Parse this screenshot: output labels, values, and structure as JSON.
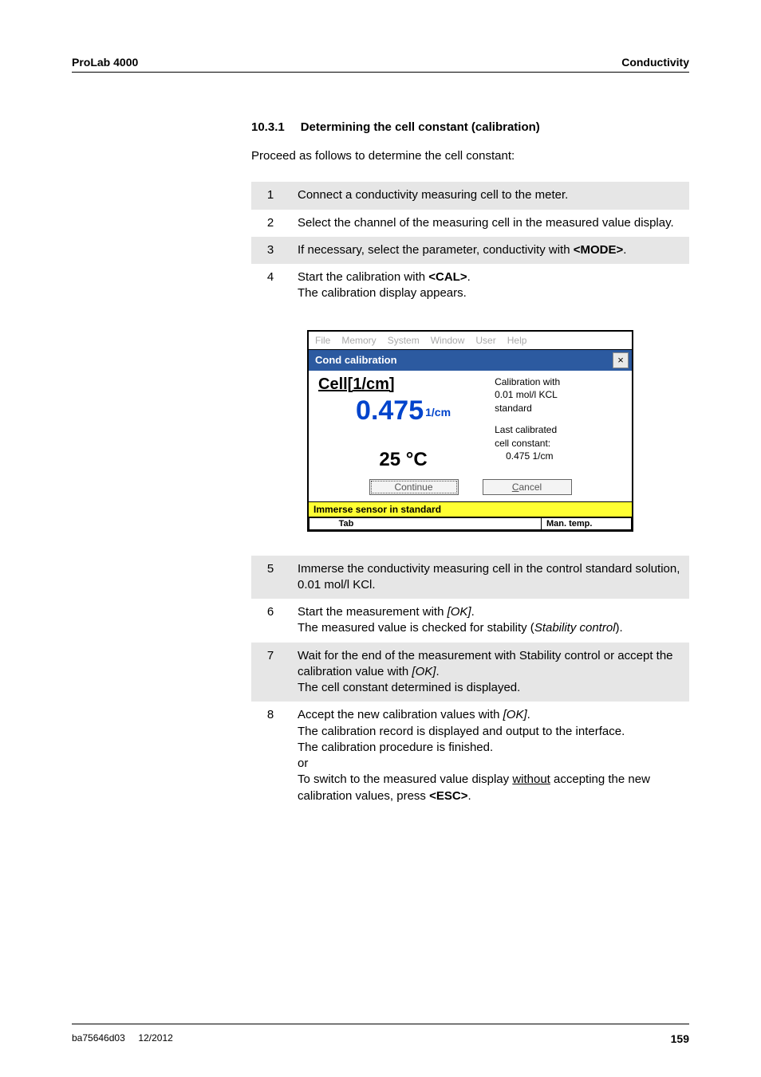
{
  "header": {
    "left": "ProLab 4000",
    "right": "Conductivity"
  },
  "section": {
    "number": "10.3.1",
    "title": "Determining the cell constant (calibration)"
  },
  "intro": "Proceed as follows to determine the cell constant:",
  "steps1": {
    "r1": {
      "n": "1",
      "t": "Connect a conductivity measuring cell to the meter."
    },
    "r2": {
      "n": "2",
      "t": "Select the channel of the measuring cell in the measured value display."
    },
    "r3": {
      "n": "3",
      "t_pre": "If necessary, select the parameter, conductivity with ",
      "key": "<MODE>",
      "t_post": "."
    },
    "r4": {
      "n": "4",
      "t_pre": "Start the calibration with ",
      "key": "<CAL>",
      "t_post": ".",
      "line2": "The calibration display appears."
    }
  },
  "dialog": {
    "menu": {
      "file": "File",
      "memory": "Memory",
      "system": "System",
      "window": "Window",
      "user": "User",
      "help": "Help"
    },
    "title": "Cond calibration",
    "close": "×",
    "cellLabel": "Cell[1/cm]",
    "value": "0.475",
    "valueUnit": "1/cm",
    "temp": "25 °C",
    "infoLine1": "Calibration with",
    "infoLine2": "0.01 mol/l KCL",
    "infoLine3": "standard",
    "infoLine4": "Last calibrated",
    "infoLine5": "cell constant:",
    "infoLine6": "0.475 1/cm",
    "btnContinue": "Continue",
    "btnCancelPrefix": "C",
    "btnCancelRest": "ancel",
    "status": "Immerse sensor in standard",
    "footTab": "Tab",
    "footMan": "Man. temp."
  },
  "steps2": {
    "r5": {
      "n": "5",
      "t": "Immerse the conductivity measuring cell in the control standard solution, 0.01 mol/l KCl."
    },
    "r6": {
      "n": "6",
      "t1": "Start the measurement with ",
      "ok": "[OK]",
      "t2": ".",
      "line2a": "The measured value is checked for stability (",
      "line2i": "Stability control",
      "line2b": ")."
    },
    "r7": {
      "n": "7",
      "t1": "Wait for the end of the measurement with Stability control or accept the calibration value with ",
      "ok": "[OK]",
      "t2": ".",
      "line2": "The cell constant determined is displayed."
    },
    "r8": {
      "n": "8",
      "l1a": "Accept the new calibration values with ",
      "ok": "[OK]",
      "l1b": ".",
      "l2": "The calibration record is displayed and output to the interface.",
      "l3": "The calibration procedure is finished.",
      "l4": "or",
      "l5a": "To switch to the measured value display ",
      "l5u": "without",
      "l5b": " accepting the new calibration values, press ",
      "key": "<ESC>",
      "l5c": "."
    }
  },
  "footer": {
    "doc": "ba75646d03",
    "date": "12/2012",
    "page": "159"
  }
}
